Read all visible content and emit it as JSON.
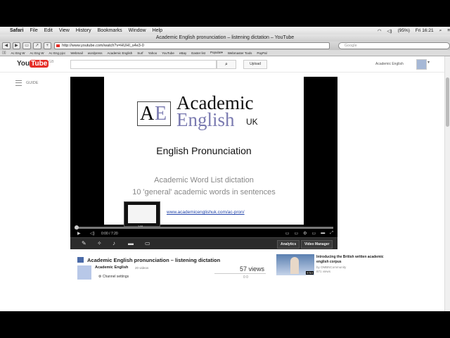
{
  "menubar": {
    "items": [
      "Safari",
      "File",
      "Edit",
      "View",
      "History",
      "Bookmarks",
      "Window",
      "Help"
    ],
    "battery": "(95%)",
    "clock": "Fri 16:21"
  },
  "window": {
    "title": "Academic English pronunciation – listening dictation – YouTube"
  },
  "toolbar": {
    "url": "http://www.youtube.com/watch?v=HUHI_s4e3-0",
    "search_placeholder": "Google"
  },
  "bookmarks": [
    "Ac Eng W",
    "Ac Eng W",
    "Ac Eng pjcc",
    "Webmail",
    "wordpress",
    "Academic English",
    "Surf",
    "Yahoo",
    "YouTube",
    "eBay",
    "Easter list",
    "Popular▾",
    "Webmaster Tools",
    "PayPal"
  ],
  "youtube": {
    "logo_you": "You",
    "logo_tube": "Tube",
    "logo_loc": "GB",
    "upload": "Upload",
    "username": "Academic English",
    "guide": "GUIDE"
  },
  "slide": {
    "logo_a": "A",
    "logo_e": "E",
    "academic": "Academic",
    "english": "English",
    "uk": "UK",
    "title": "English Pronunciation",
    "line1": "Academic Word List dictation",
    "line2": "10 'general' academic words in sentences",
    "url": "www.academicenglishuk.com/ac-pron/"
  },
  "player": {
    "preview_time": "1:51",
    "time": "0:00 / 7:20",
    "analytics": "Analytics",
    "video_manager": "Video Manager",
    "progress": 0.0
  },
  "video": {
    "title": "Academic English pronunciation – listening dictation",
    "channel": "Academic English",
    "channel_videos": "20 videos",
    "views": "57 views",
    "channel_settings": "Channel settings",
    "likes": "0    0"
  },
  "related": {
    "title1": "Introducing the British written academic",
    "title2": "english corpus",
    "by": "by OMBNCommunity",
    "views": "871 views",
    "duration": "8:54"
  },
  "colors": {
    "youtube_red": "#e52d27",
    "ae_purple": "#7a7ab0"
  },
  "dock": [
    "finder-icon",
    "dashboard-icon",
    "preview-icon",
    "safari-icon",
    "firefox-icon",
    "chrome-icon",
    "photos-icon",
    "mail-icon",
    "sketch-icon",
    "calendar-icon",
    "notes-icon",
    "photo-booth-icon",
    "system-prefs-icon",
    "printer-icon",
    "iphoto-icon",
    "itunes-icon",
    "tools-icon",
    "trash-icon"
  ]
}
